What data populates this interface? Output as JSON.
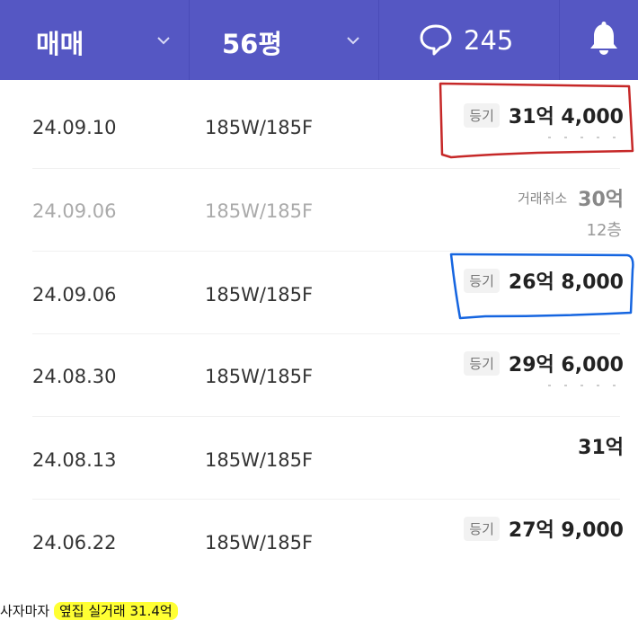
{
  "header": {
    "trade_type": "매매",
    "area": "56평",
    "comments_count": "245"
  },
  "rows": [
    {
      "date": "24.09.10",
      "floor": "185W/185F",
      "badge": "등기",
      "price": "31억 4,000",
      "sub": ""
    },
    {
      "date": "24.09.06",
      "floor": "185W/185F",
      "badge": "거래취소",
      "price": "30억",
      "sub": "12층"
    },
    {
      "date": "24.09.06",
      "floor": "185W/185F",
      "badge": "등기",
      "price": "26억 8,000",
      "sub": ""
    },
    {
      "date": "24.08.30",
      "floor": "185W/185F",
      "badge": "등기",
      "price": "29억 6,000",
      "sub": ""
    },
    {
      "date": "24.08.13",
      "floor": "185W/185F",
      "badge": "",
      "price": "31억",
      "sub": ""
    },
    {
      "date": "24.06.22",
      "floor": "185W/185F",
      "badge": "등기",
      "price": "27억 9,000",
      "sub": ""
    }
  ],
  "caption": {
    "prefix": "사자마자 ",
    "highlight": "옆집 실거래 31.4억"
  },
  "colors": {
    "header_bg": "#5557c3",
    "annotation_red": "#c62828",
    "annotation_blue": "#1565e0",
    "highlight": "#ffff33"
  }
}
